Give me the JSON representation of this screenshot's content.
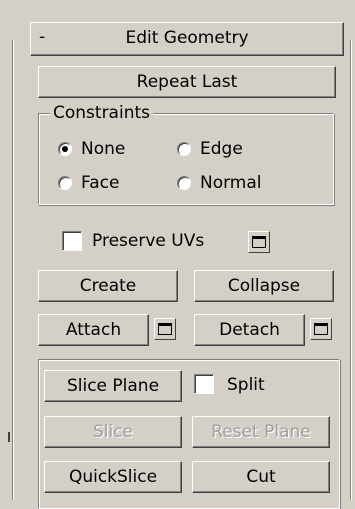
{
  "rollout": {
    "collapse_symbol": "-",
    "title": "Edit Geometry"
  },
  "buttons": {
    "repeat_last": "Repeat Last",
    "create": "Create",
    "collapse": "Collapse",
    "attach": "Attach",
    "detach": "Detach",
    "slice_plane": "Slice Plane",
    "slice": "Slice",
    "reset_plane": "Reset Plane",
    "quickslice": "QuickSlice",
    "cut": "Cut"
  },
  "constraints": {
    "legend": "Constraints",
    "selected": "None",
    "options": [
      "None",
      "Edge",
      "Face",
      "Normal"
    ]
  },
  "preserve_uvs": {
    "label": "Preserve UVs",
    "checked": false
  },
  "split": {
    "label": "Split",
    "checked": false
  },
  "icons": {
    "settings": "settings-icon"
  }
}
